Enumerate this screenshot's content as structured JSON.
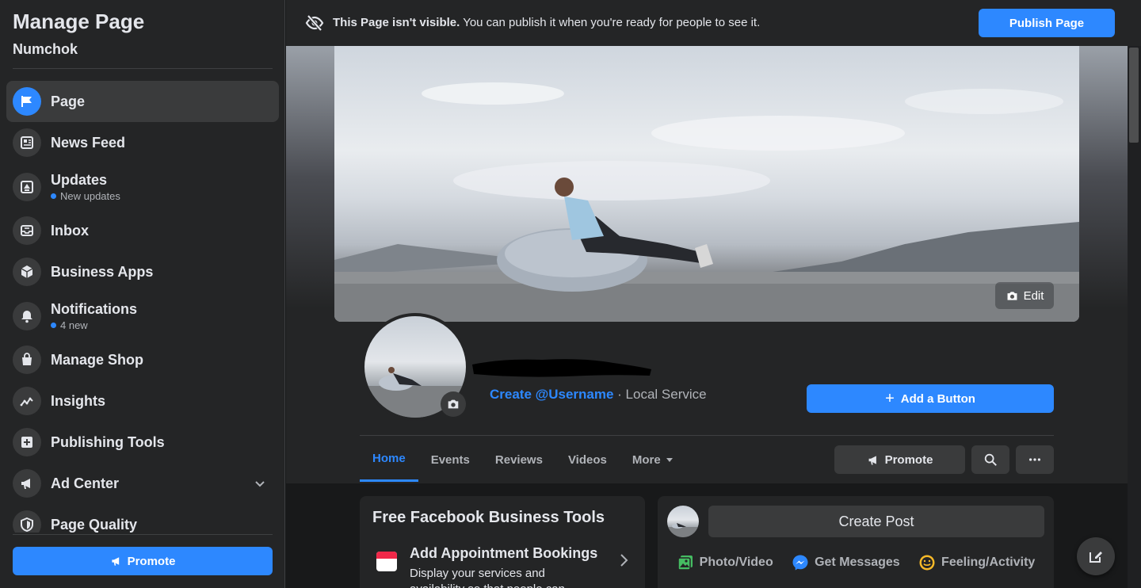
{
  "sidebar": {
    "title": "Manage Page",
    "page_name": "Numchok",
    "items": [
      {
        "label": "Page",
        "meta": "",
        "icon": "flag-icon"
      },
      {
        "label": "News Feed",
        "meta": "",
        "icon": "news-feed-icon"
      },
      {
        "label": "Updates",
        "meta": "New updates",
        "icon": "updates-icon"
      },
      {
        "label": "Inbox",
        "meta": "",
        "icon": "inbox-icon"
      },
      {
        "label": "Business Apps",
        "meta": "",
        "icon": "cube-icon"
      },
      {
        "label": "Notifications",
        "meta": "4 new",
        "icon": "bell-icon"
      },
      {
        "label": "Manage Shop",
        "meta": "",
        "icon": "shopping-bag-icon"
      },
      {
        "label": "Insights",
        "meta": "",
        "icon": "insights-icon"
      },
      {
        "label": "Publishing Tools",
        "meta": "",
        "icon": "publishing-tools-icon"
      },
      {
        "label": "Ad Center",
        "meta": "",
        "icon": "megaphone-icon"
      },
      {
        "label": "Page Quality",
        "meta": "",
        "icon": "shield-icon"
      }
    ],
    "promote_label": "Promote"
  },
  "banner": {
    "bold_text": "This Page isn't visible.",
    "text": " You can publish it when you're ready for people to see it.",
    "publish_label": "Publish Page"
  },
  "cover": {
    "edit_label": "Edit"
  },
  "profile": {
    "username_link": "Create @Username",
    "separator": " · ",
    "category": "Local Service",
    "add_button_label": "Add a Button"
  },
  "tabs": [
    {
      "label": "Home"
    },
    {
      "label": "Events"
    },
    {
      "label": "Reviews"
    },
    {
      "label": "Videos"
    },
    {
      "label": "More"
    }
  ],
  "actions": {
    "promote_label": "Promote"
  },
  "tools_card": {
    "title": "Free Facebook Business Tools",
    "tool_title": "Add Appointment Bookings",
    "tool_desc": "Display your services and availability so that people can"
  },
  "create_post": {
    "label": "Create Post",
    "photo_video": "Photo/Video",
    "get_messages": "Get Messages",
    "feeling_activity": "Feeling/Activity"
  },
  "colors": {
    "accent": "#2d88ff",
    "surface": "#242526",
    "background": "#18191a"
  }
}
